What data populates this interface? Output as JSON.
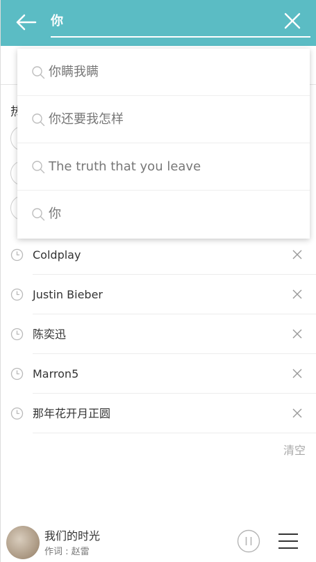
{
  "header": {
    "search_value": "你"
  },
  "hot": {
    "label": "热"
  },
  "suggestions": [
    {
      "text": "你瞒我瞒"
    },
    {
      "text": "你还要我怎样"
    },
    {
      "text": "The truth that you leave"
    },
    {
      "text": "你"
    }
  ],
  "history": [
    {
      "text": "Coldplay"
    },
    {
      "text": "Justin Bieber"
    },
    {
      "text": "陈奕迅"
    },
    {
      "text": "Marron5"
    },
    {
      "text": "那年花开月正圆"
    }
  ],
  "clear_all_label": "清空",
  "player": {
    "title": "我们的时光",
    "subtitle": "作词 : 赵雷"
  },
  "colors": {
    "accent": "#5bbcc4"
  }
}
